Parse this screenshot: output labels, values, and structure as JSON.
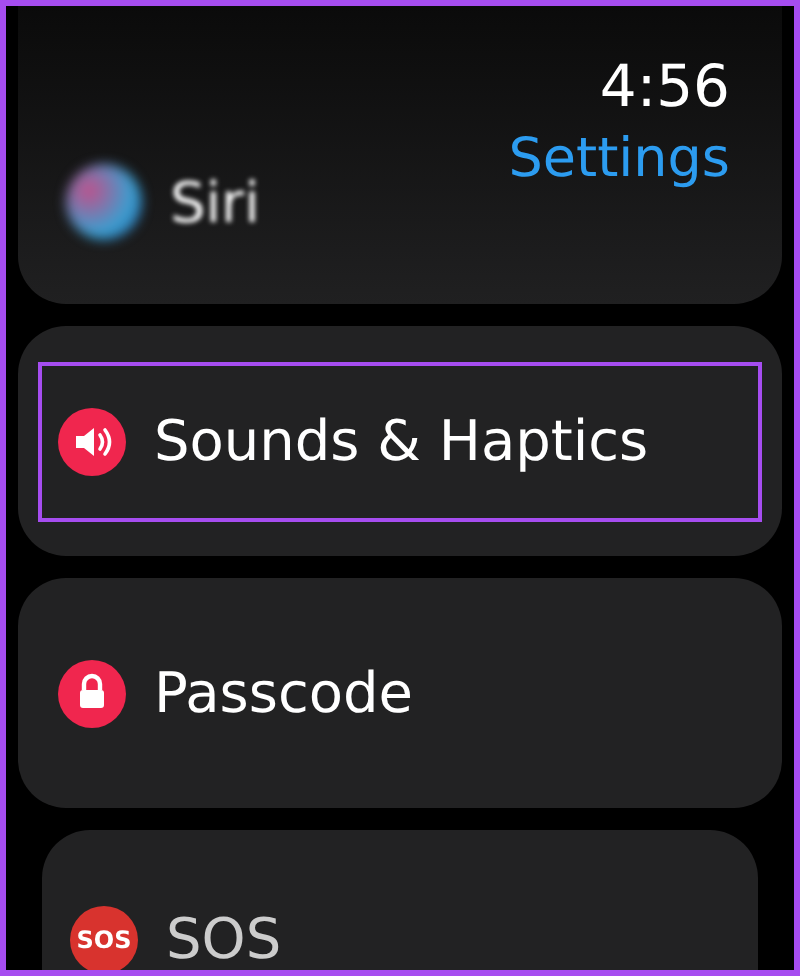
{
  "status": {
    "time": "4:56",
    "title": "Settings"
  },
  "items": [
    {
      "label": "Siri",
      "selected": false
    },
    {
      "label": "Sounds & Haptics",
      "selected": true
    },
    {
      "label": "Passcode",
      "selected": false
    },
    {
      "label": "SOS",
      "badge": "SOS",
      "selected": false
    }
  ]
}
